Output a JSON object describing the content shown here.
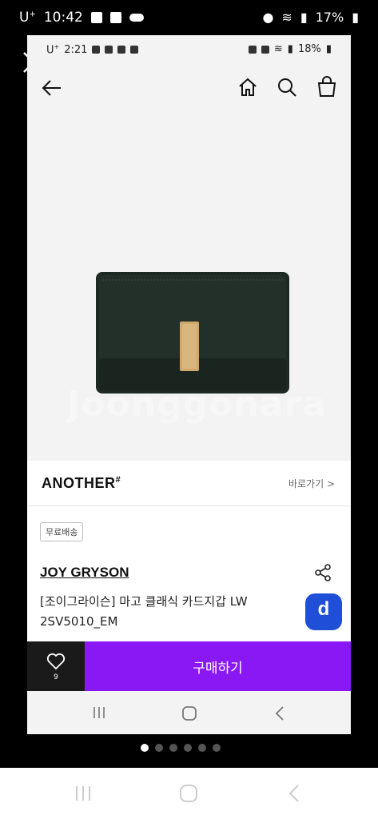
{
  "outer_status": {
    "carrier": "U",
    "carrier_sup": "+",
    "time": "10:42",
    "battery": "17%"
  },
  "inner_status": {
    "carrier": "U",
    "carrier_sup": "+",
    "time": "2:21",
    "battery": "18%"
  },
  "brand_row": {
    "name": "ANOTHER",
    "name_mark": "#",
    "link": "바로가기 >"
  },
  "product": {
    "badge": "무료배송",
    "brand": "JOY GRYSON",
    "name": "[조이그라이슨] 마고 클래식 카드지갑 LW 2SV5010_EM",
    "like_count": "9",
    "buy_label": "구매하기",
    "d_label": "d"
  },
  "watermark": "Joonggonara",
  "colors": {
    "buy_purple": "#8a18f5",
    "d_blue": "#1f4fd6",
    "wallet_green": "#223029",
    "clasp_gold": "#cfa86a"
  },
  "pager": {
    "count": 6,
    "active_index": 0
  }
}
